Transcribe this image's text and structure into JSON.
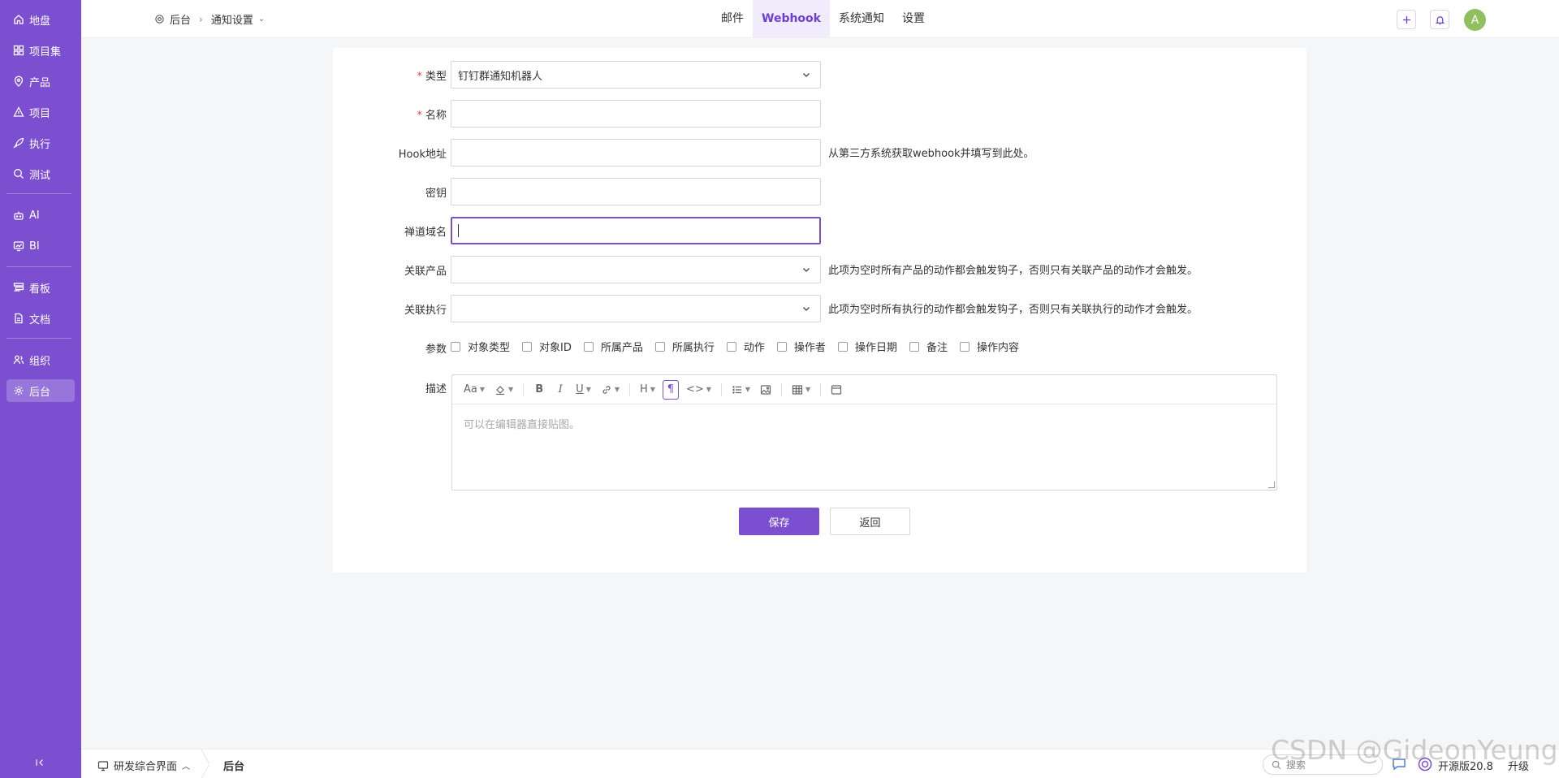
{
  "sidebar": {
    "items": [
      {
        "label": "地盘",
        "icon": "home-icon"
      },
      {
        "label": "项目集",
        "icon": "grid-icon"
      },
      {
        "label": "产品",
        "icon": "location-pin-icon"
      },
      {
        "label": "项目",
        "icon": "project-icon"
      },
      {
        "label": "执行",
        "icon": "rocket-icon"
      },
      {
        "label": "测试",
        "icon": "search-bug-icon"
      },
      {
        "label": "AI",
        "icon": "robot-icon"
      },
      {
        "label": "BI",
        "icon": "chart-icon"
      },
      {
        "label": "看板",
        "icon": "kanban-icon"
      },
      {
        "label": "文档",
        "icon": "document-icon"
      },
      {
        "label": "组织",
        "icon": "people-icon"
      },
      {
        "label": "后台",
        "icon": "gear-icon",
        "active": true
      }
    ]
  },
  "header": {
    "breadcrumb_root": "后台",
    "breadcrumb_current": "通知设置",
    "nav": [
      "邮件",
      "Webhook",
      "系统通知",
      "设置"
    ],
    "active_nav": "Webhook",
    "avatar_letter": "A"
  },
  "form": {
    "type_label": "类型",
    "type_value": "钉钉群通知机器人",
    "name_label": "名称",
    "name_value": "",
    "hook_label": "Hook地址",
    "hook_value": "",
    "hook_hint": "从第三方系统获取webhook并填写到此处。",
    "secret_label": "密钥",
    "secret_value": "",
    "domain_label": "禅道域名",
    "domain_value": "",
    "product_label": "关联产品",
    "product_hint": "此项为空时所有产品的动作都会触发钩子，否则只有关联产品的动作才会触发。",
    "execution_label": "关联执行",
    "execution_hint": "此项为空时所有执行的动作都会触发钩子，否则只有关联执行的动作才会触发。",
    "params_label": "参数",
    "params": [
      "对象类型",
      "对象ID",
      "所属产品",
      "所属执行",
      "动作",
      "操作者",
      "操作日期",
      "备注",
      "操作内容"
    ],
    "desc_label": "描述",
    "editor_placeholder": "可以在编辑器直接贴图。",
    "save_label": "保存",
    "back_label": "返回"
  },
  "footer": {
    "app_switcher": "研发综合界面",
    "current": "后台",
    "search_placeholder": "搜索",
    "version": "开源版20.8",
    "upgrade": "升级"
  },
  "watermark": "CSDN @GideonYeung",
  "colors": {
    "brand": "#7b4fd0",
    "required": "#e5484d"
  }
}
